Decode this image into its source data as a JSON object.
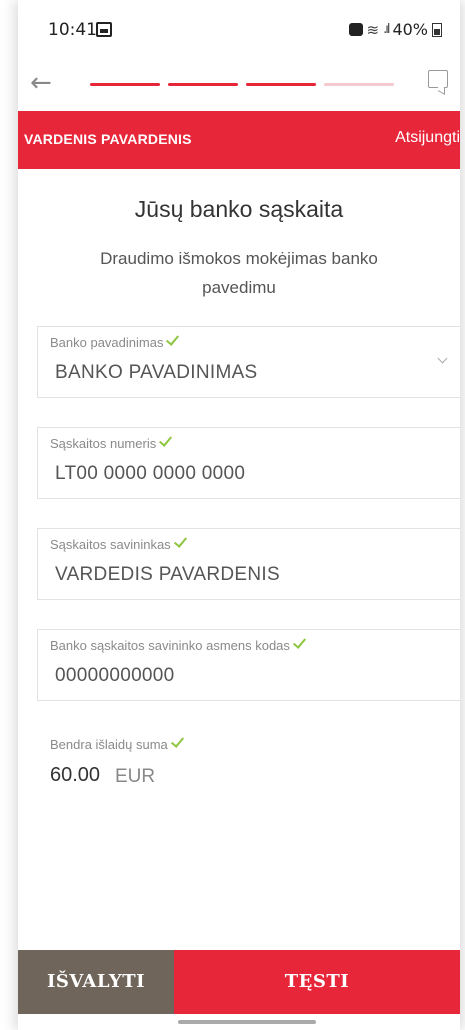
{
  "status_bar": {
    "time": "10:41",
    "battery": "40%",
    "icons": [
      "image-icon",
      "alarm-icon",
      "wifi-icon",
      "signal-icon",
      "battery-icon"
    ]
  },
  "nav": {
    "back_icon": "←",
    "progress": {
      "total_steps": 4,
      "completed_steps": 3,
      "active_color": "#e8263a",
      "inactive_color": "#f6c9ce"
    },
    "chat_icon": "chat-icon"
  },
  "header": {
    "user_name": "VARDENIS PAVARDENIS",
    "logout_label": "Atsijungti",
    "background": "#e8263a"
  },
  "page": {
    "title": "Jūsų banko sąskaita",
    "subtitle": "Draudimo išmokos mokėjimas banko pavedimu"
  },
  "fields": {
    "bank_name": {
      "label": "Banko pavadinimas",
      "value": "BANKO PAVADINIMAS"
    },
    "account_number": {
      "label": "Sąskaitos numeris",
      "value": "LT00 0000 0000 0000"
    },
    "account_owner": {
      "label": "Sąskaitos savininkas",
      "value": "VARDEDIS PAVARDENIS"
    },
    "owner_code": {
      "label": "Banko sąskaitos savininko asmens kodas",
      "value": "00000000000"
    }
  },
  "total": {
    "label": "Bendra išlaidų suma",
    "amount": "60.00",
    "currency": "EUR"
  },
  "buttons": {
    "clear_label": "IŠVALYTI",
    "next_label": "TĘSTI",
    "clear_color": "#6f655a",
    "next_color": "#e8263a"
  },
  "colors": {
    "check": "#8dc63f"
  }
}
